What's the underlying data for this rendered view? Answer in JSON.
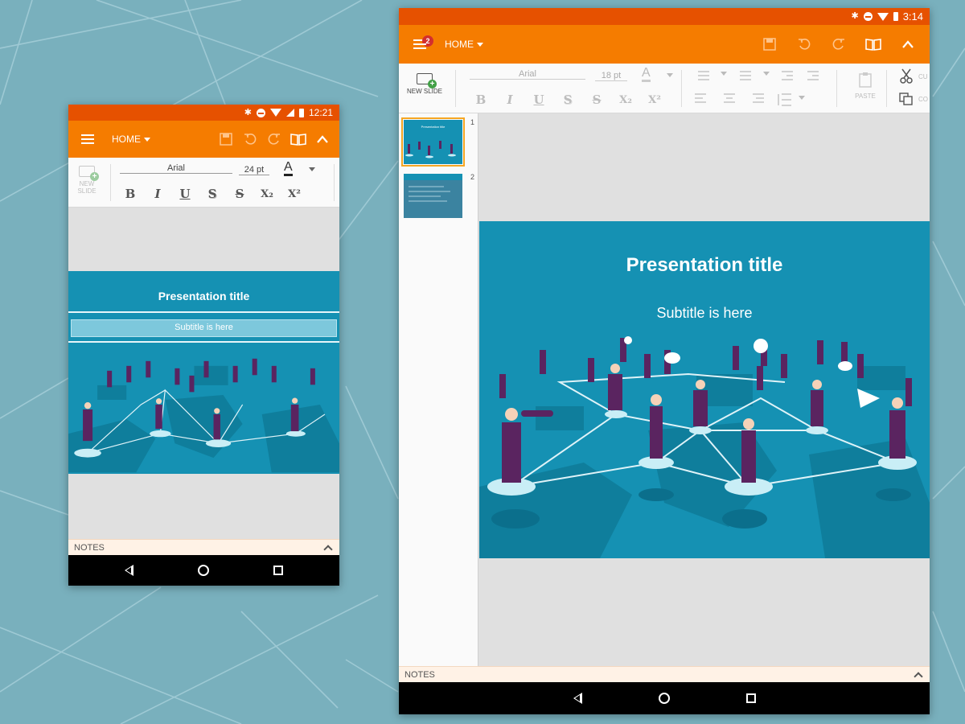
{
  "phone": {
    "status": {
      "time": "12:21"
    },
    "app_bar": {
      "menu_label": "HOME"
    },
    "toolbar": {
      "new_slide_label": "NEW\nSLIDE",
      "font_name": "Arial",
      "font_size": "24 pt",
      "font_color_glyph": "A",
      "bold": "B",
      "italic": "I",
      "underline": "U",
      "shadow": "S",
      "strike": "S",
      "subscript": "X₂",
      "superscript": "X²"
    },
    "slide": {
      "title": "Presentation title",
      "subtitle": "Subtitle is here"
    },
    "notes_label": "NOTES"
  },
  "tablet": {
    "status": {
      "time": "3:14"
    },
    "app_bar": {
      "menu_label": "HOME",
      "notification_count": "2"
    },
    "toolbar": {
      "new_slide_label": "NEW SLIDE",
      "font_name": "Arial",
      "font_size": "18 pt",
      "font_color_glyph": "A",
      "bold": "B",
      "italic": "I",
      "underline": "U",
      "shadow": "S",
      "strike": "S",
      "subscript": "X₂",
      "superscript": "X²",
      "paste_label": "PASTE",
      "cut_label_partial": "CU",
      "copy_label_partial": "CO"
    },
    "thumbnails": [
      {
        "number": "1",
        "selected": true
      },
      {
        "number": "2",
        "selected": false
      }
    ],
    "slide": {
      "title": "Presentation title",
      "subtitle": "Subtitle is here"
    },
    "notes_label": "NOTES"
  },
  "colors": {
    "status_bar": "#e65100",
    "app_bar": "#f57c00",
    "slide_bg": "#1591b3",
    "background": "#79b0bd",
    "figure": "#5a2460"
  }
}
